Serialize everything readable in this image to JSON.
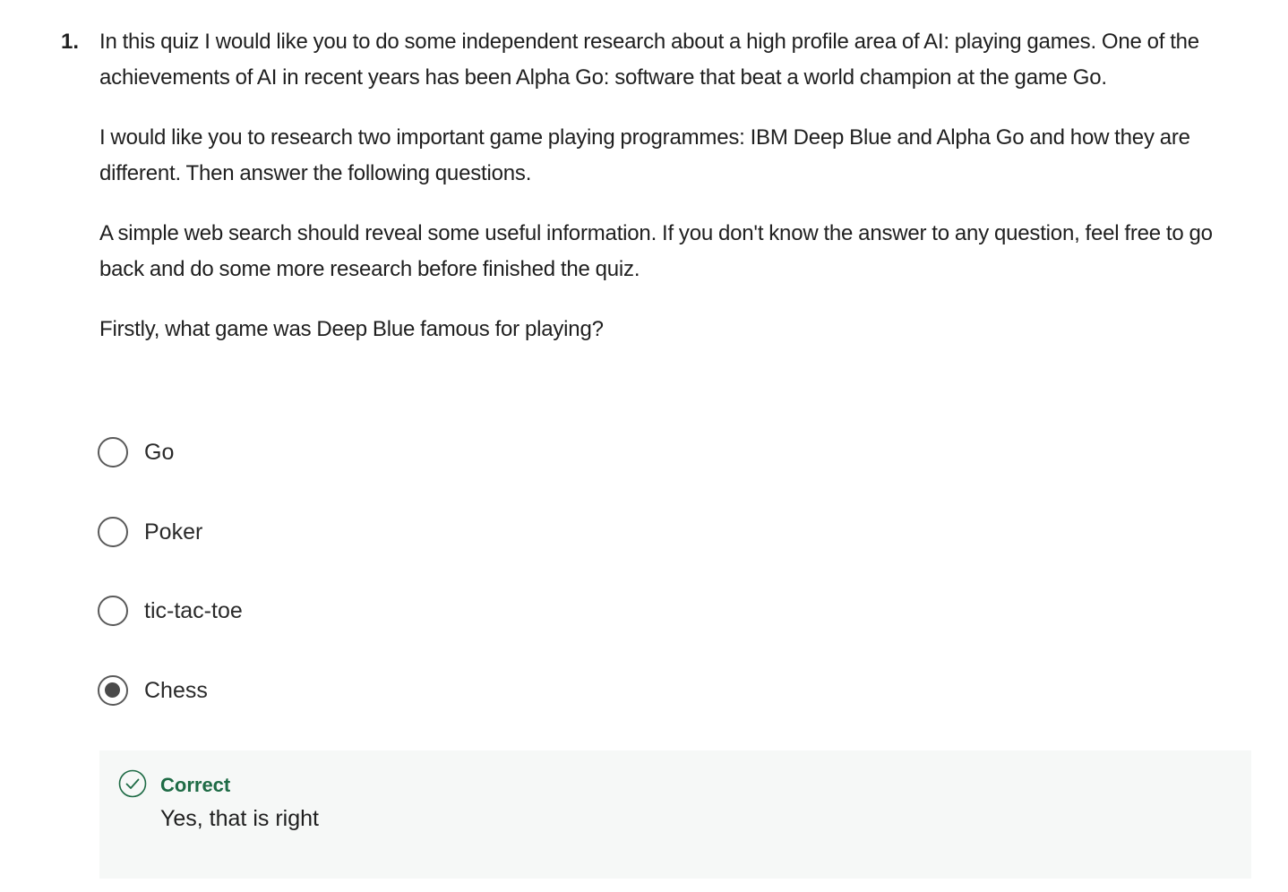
{
  "question": {
    "number": "1.",
    "paragraphs": [
      "In this quiz I would like you to do some independent research about a high profile area of AI: playing games. One of the achievements of AI in recent years has been Alpha Go: software that beat a world champion at the game Go.",
      "I would like you to research two important game playing programmes: IBM Deep Blue and Alpha Go and how they are different. Then answer the following questions.",
      "A simple web search should reveal some useful information. If you don't know the answer to any question, feel free to go back and do some more research before finished the quiz."
    ],
    "prompt": "Firstly, what game was Deep Blue famous for playing?",
    "options": [
      {
        "label": "Go",
        "selected": false
      },
      {
        "label": "Poker",
        "selected": false
      },
      {
        "label": "tic-tac-toe",
        "selected": false
      },
      {
        "label": "Chess",
        "selected": true
      }
    ]
  },
  "feedback": {
    "status": "Correct",
    "message": "Yes, that is right",
    "icon": "check-circle-icon",
    "status_color": "#1e6b45"
  }
}
